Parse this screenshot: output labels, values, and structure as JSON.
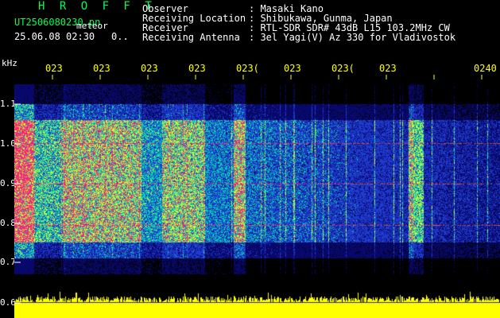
{
  "header": {
    "program": "H R O F F T",
    "filename": "UT2506080230.pn",
    "meteor_label": "meteor",
    "timestamp": "25.06.08 02:30",
    "timestamp_suffix": "0..",
    "fields": [
      {
        "label": "Observer",
        "value": ": Masaki Kano"
      },
      {
        "label": "Receiving Location",
        "value": ": Shibukawa, Gunma, Japan"
      },
      {
        "label": "Receiver",
        "value": ": RTL-SDR SDR# 43dB L15 103.2MHz CW"
      },
      {
        "label": "Receiving Antenna",
        "value": ": 3el Yagi(V) Az 330 for Vladivostok"
      }
    ]
  },
  "axis": {
    "unit": "kHz",
    "y_labels": [
      "1.1",
      "1.0",
      "0.9",
      "0.8",
      "0.7",
      "0.6"
    ],
    "x_labels": [
      "023",
      "023",
      "023",
      "023",
      "023(",
      "023",
      "023(",
      "023",
      "0240"
    ]
  },
  "colors": {
    "background": "#000000",
    "signal_hot": "#ff1f7a",
    "signal_mid": "#00d9b0",
    "signal_low": "#1f3bd0",
    "power_trace": "#ffff00",
    "text_green": "#00ff55"
  }
}
